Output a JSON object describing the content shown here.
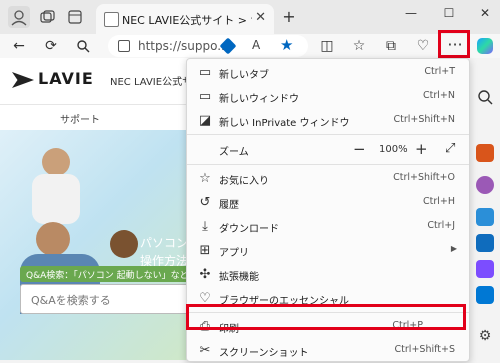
{
  "tab": {
    "title": "NEC LAVIE公式サイト > サービス&サ"
  },
  "address": {
    "url": "https://suppo..."
  },
  "site": {
    "logo_text": "LAVIE",
    "header_text": "NEC LAVIE公式サイト",
    "nav_item": "サポート",
    "hero_text_1": "パソコン",
    "hero_text_2": "操作方法",
    "qa_tag": "Q&A検索：「パソコン 起動しない」など",
    "search_placeholder": "Q&Aを検索する"
  },
  "menu": {
    "items": [
      {
        "label": "新しいタブ",
        "shortcut": "Ctrl+T",
        "icon": "new-tab-icon"
      },
      {
        "label": "新しいウィンドウ",
        "shortcut": "Ctrl+N",
        "icon": "new-window-icon"
      },
      {
        "label": "新しい InPrivate ウィンドウ",
        "shortcut": "Ctrl+Shift+N",
        "icon": "inprivate-icon"
      },
      {
        "label": "お気に入り",
        "shortcut": "Ctrl+Shift+O",
        "icon": "favorites-icon"
      },
      {
        "label": "履歴",
        "shortcut": "Ctrl+H",
        "icon": "history-icon"
      },
      {
        "label": "ダウンロード",
        "shortcut": "Ctrl+J",
        "icon": "download-icon"
      },
      {
        "label": "アプリ",
        "shortcut": "",
        "icon": "apps-icon"
      },
      {
        "label": "拡張機能",
        "shortcut": "",
        "icon": "extensions-icon"
      },
      {
        "label": "ブラウザーのエッセンシャル",
        "shortcut": "",
        "icon": "essentials-icon"
      },
      {
        "label": "印刷",
        "shortcut": "Ctrl+P",
        "icon": "print-icon"
      },
      {
        "label": "スクリーンショット",
        "shortcut": "Ctrl+Shift+S",
        "icon": "screenshot-icon"
      }
    ],
    "zoom": {
      "label": "ズーム",
      "value": "100%",
      "minus": "−",
      "plus": "+"
    }
  },
  "colors": {
    "highlight": "#e2001a",
    "accent": "#0067c0"
  }
}
